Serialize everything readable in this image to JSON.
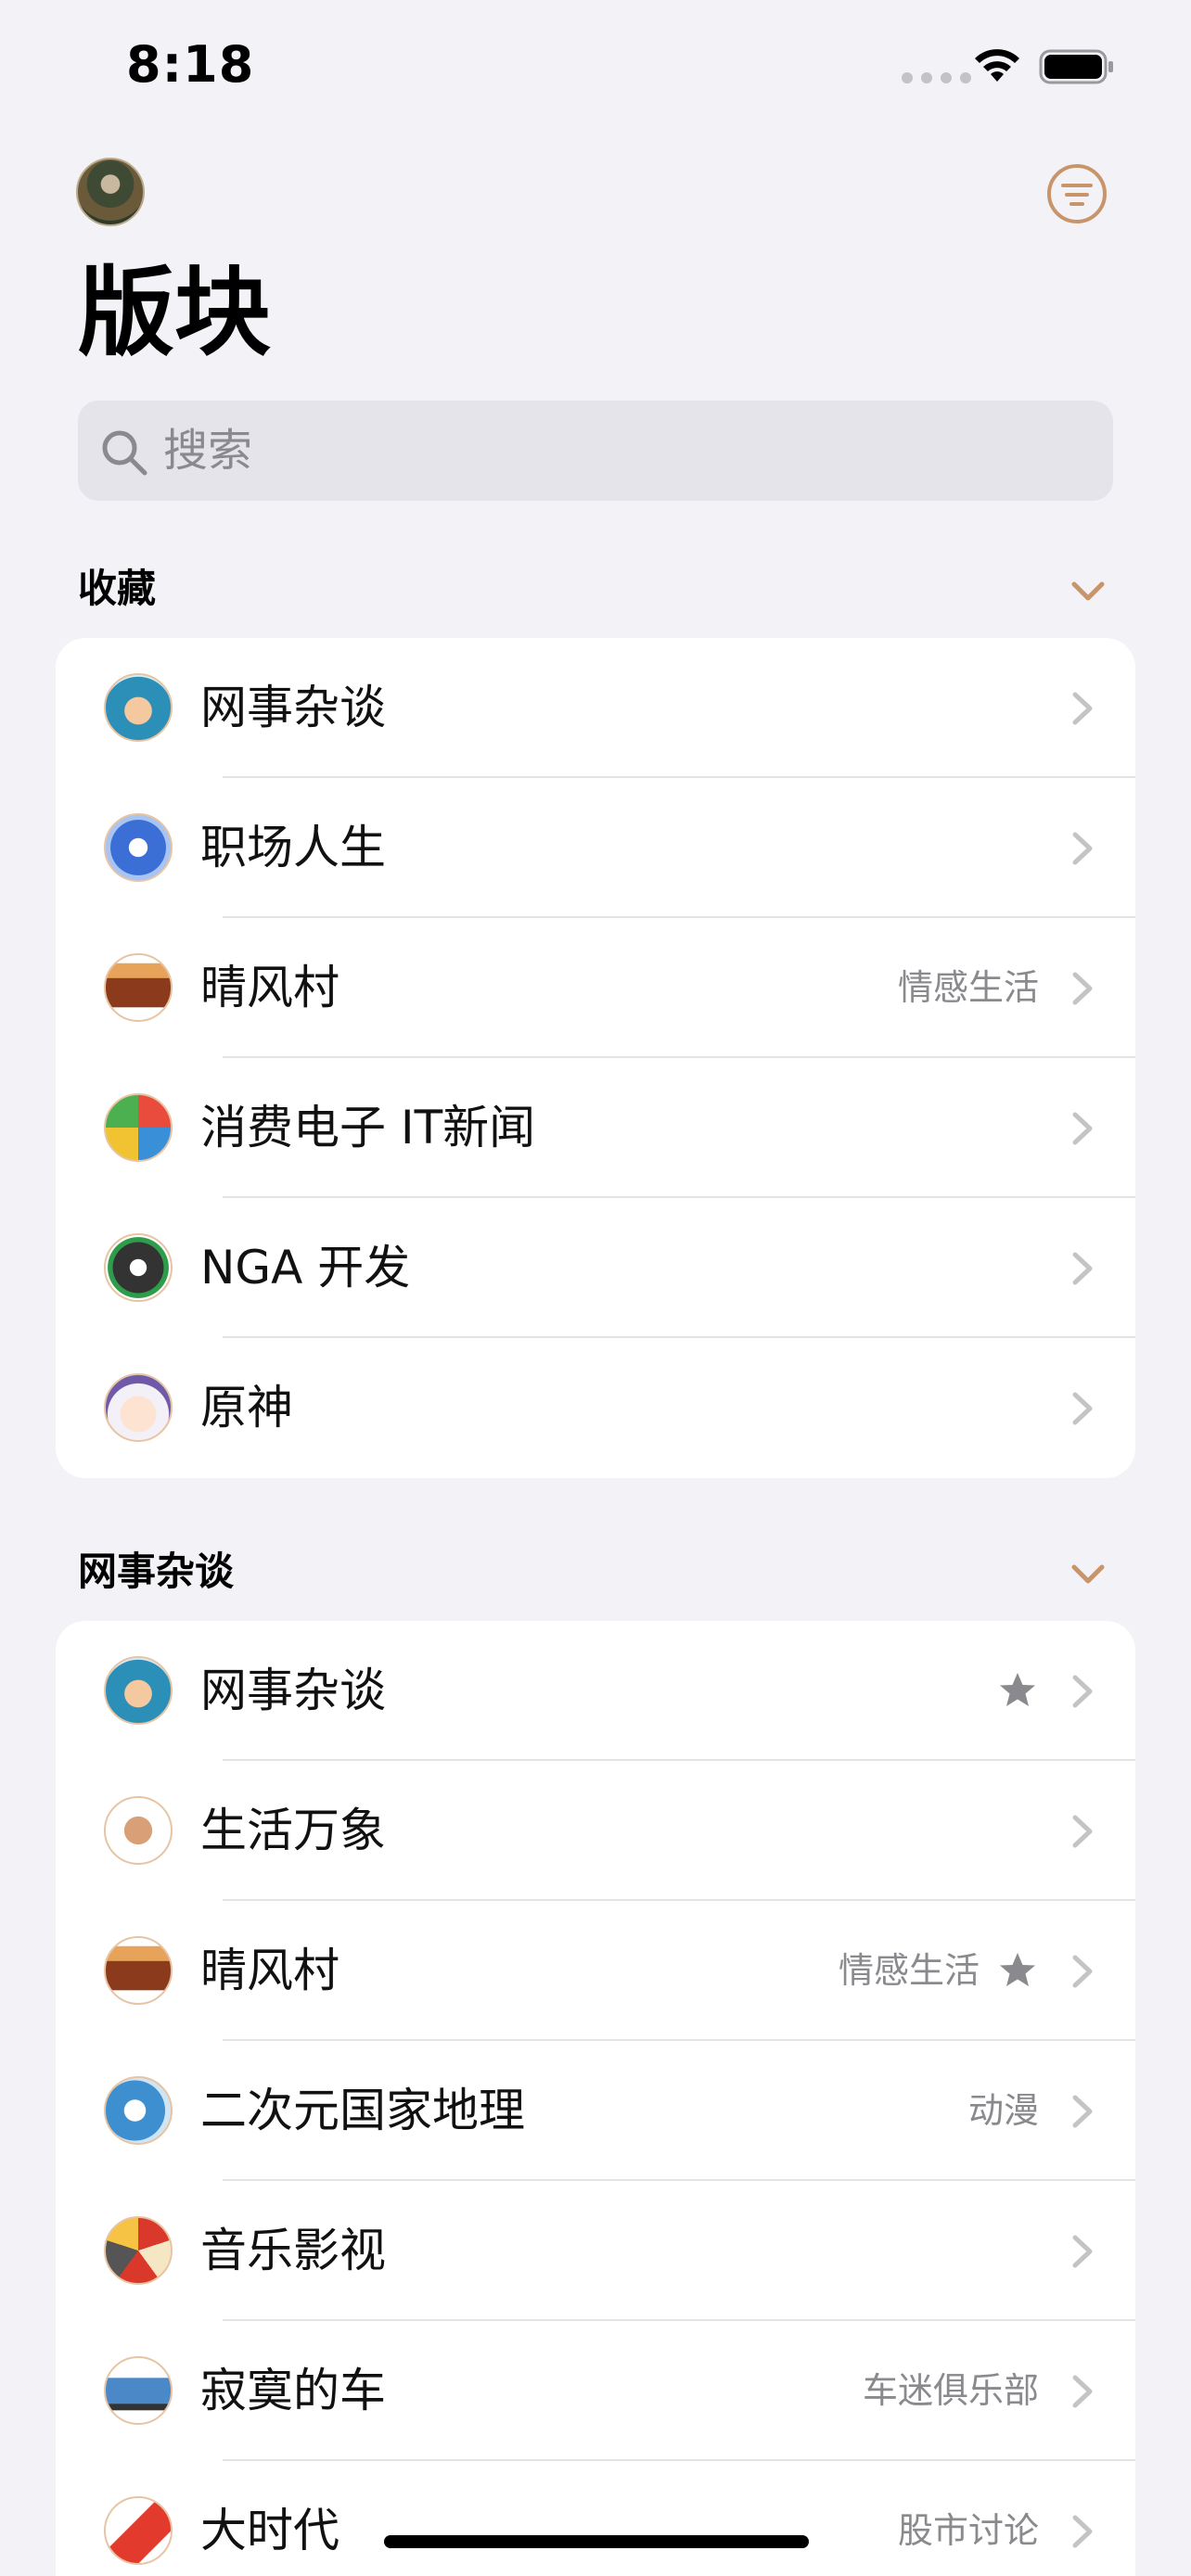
{
  "status_bar": {
    "time": "8:18"
  },
  "header": {
    "title": "版块"
  },
  "search": {
    "placeholder": "搜索"
  },
  "colors": {
    "accent": "#c8956a",
    "background": "#f2f2f7",
    "card": "#ffffff",
    "secondary_text": "#8a8a8e"
  },
  "sections": [
    {
      "title": "收藏",
      "items": [
        {
          "label": "网事杂谈",
          "subtitle": "",
          "starred": false,
          "icon": "thumbs-up-icon"
        },
        {
          "label": "职场人生",
          "subtitle": "",
          "starred": false,
          "icon": "workplace-badge-icon"
        },
        {
          "label": "晴风村",
          "subtitle": "情感生活",
          "starred": false,
          "icon": "torch-icon"
        },
        {
          "label": "消费电子 IT新闻",
          "subtitle": "",
          "starred": false,
          "icon": "devices-collage-icon"
        },
        {
          "label": "NGA 开发",
          "subtitle": "",
          "starred": false,
          "icon": "gear-wrench-icon"
        },
        {
          "label": "原神",
          "subtitle": "",
          "starred": false,
          "icon": "anime-character-icon"
        }
      ]
    },
    {
      "title": "网事杂谈",
      "items": [
        {
          "label": "网事杂谈",
          "subtitle": "",
          "starred": true,
          "icon": "thumbs-up-icon"
        },
        {
          "label": "生活万象",
          "subtitle": "",
          "starred": false,
          "icon": "paw-card-icon"
        },
        {
          "label": "晴风村",
          "subtitle": "情感生活",
          "starred": true,
          "icon": "torch-icon"
        },
        {
          "label": "二次元国家地理",
          "subtitle": "动漫",
          "starred": false,
          "icon": "cartoon-bird-icon"
        },
        {
          "label": "音乐影视",
          "subtitle": "",
          "starred": false,
          "icon": "popcorn-film-icon"
        },
        {
          "label": "寂寞的车",
          "subtitle": "车迷俱乐部",
          "starred": false,
          "icon": "car-icon"
        },
        {
          "label": "大时代",
          "subtitle": "股市讨论",
          "starred": false,
          "icon": "bull-chart-icon"
        }
      ]
    }
  ]
}
